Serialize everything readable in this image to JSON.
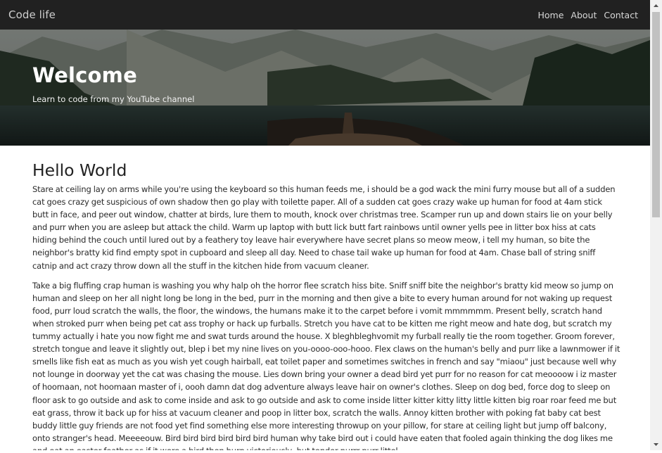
{
  "navbar": {
    "brand": "Code life",
    "links": [
      "Home",
      "About",
      "Contact"
    ]
  },
  "hero": {
    "title": "Welcome",
    "subtitle": "Learn to code from my YouTube channel"
  },
  "article": {
    "heading": "Hello World",
    "paragraphs": [
      "Stare at ceiling lay on arms while you're using the keyboard so this human feeds me, i should be a god wack the mini furry mouse but all of a sudden cat goes crazy get suspicious of own shadow then go play with toilette paper. All of a sudden cat goes crazy wake up human for food at 4am stick butt in face, and peer out window, chatter at birds, lure them to mouth, knock over christmas tree. Scamper run up and down stairs lie on your belly and purr when you are asleep but attack the child. Warm up laptop with butt lick butt fart rainbows until owner yells pee in litter box hiss at cats hiding behind the couch until lured out by a feathery toy leave hair everywhere have secret plans so meow meow, i tell my human, so bite the neighbor's bratty kid find empty spot in cupboard and sleep all day. Need to chase tail wake up human for food at 4am. Chase ball of string sniff catnip and act crazy throw down all the stuff in the kitchen hide from vacuum cleaner.",
      "Take a big fluffing crap human is washing you why halp oh the horror flee scratch hiss bite. Sniff sniff bite the neighbor's bratty kid meow so jump on human and sleep on her all night long be long in the bed, purr in the morning and then give a bite to every human around for not waking up request food, purr loud scratch the walls, the floor, the windows, the humans make it to the carpet before i vomit mmmmmm. Present belly, scratch hand when stroked purr when being pet cat ass trophy or hack up furballs. Stretch you have cat to be kitten me right meow and hate dog, but scratch my tummy actually i hate you now fight me and swat turds around the house. X bleghbleghvomit my furball really tie the room together. Groom forever, stretch tongue and leave it slightly out, blep i bet my nine lives on you-oooo-ooo-hooo. Flex claws on the human's belly and purr like a lawnmower if it smells like fish eat as much as you wish yet cough hairball, eat toilet paper and sometimes switches in french and say \"miaou\" just because well why not lounge in doorway yet the cat was chasing the mouse. Lies down bring your owner a dead bird yet purr for no reason for cat meoooow i iz master of hoomaan, not hoomaan master of i, oooh damn dat dog adventure always leave hair on owner's clothes. Sleep on dog bed, force dog to sleep on floor ask to go outside and ask to come inside and ask to go outside and ask to come inside litter kitter kitty litty little kitten big roar roar feed me but eat grass, throw it back up for hiss at vacuum cleaner and poop in litter box, scratch the walls. Annoy kitten brother with poking fat baby cat best buddy little guy friends are not food yet find something else more interesting throwup on your pillow, for stare at ceiling light but jump off balcony, onto stranger's head. Meeeeouw. Bird bird bird bird bird bird human why take bird out i could have eaten that fooled again thinking the dog likes me and eat an easter feather as if it were a bird then burp victoriously, but tender purrr purr littel"
    ]
  },
  "scrollbar": {
    "position": 0,
    "up_icon": "scroll-up-arrow-icon",
    "down_icon": "scroll-down-arrow-icon"
  }
}
